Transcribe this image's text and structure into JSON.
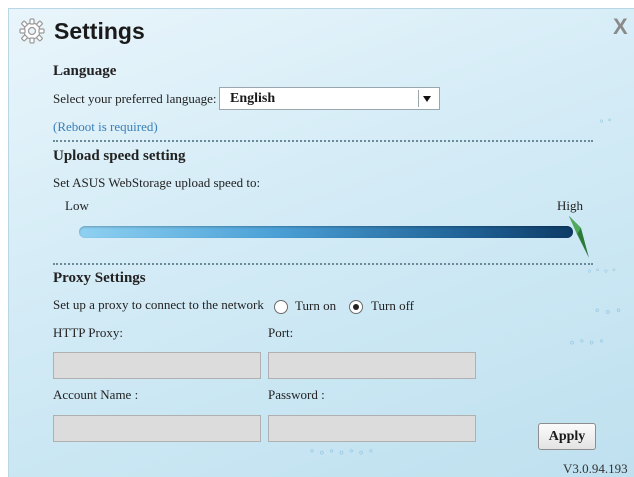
{
  "window": {
    "title": "Settings",
    "close_label": "X",
    "icon": "gear-icon"
  },
  "language": {
    "heading": "Language",
    "prompt": "Select your preferred language:",
    "selected": "English",
    "note": "(Reboot is required)"
  },
  "upload": {
    "heading": "Upload speed setting",
    "prompt": "Set ASUS WebStorage upload speed to:",
    "low_label": "Low",
    "high_label": "High",
    "level": 1.0
  },
  "proxy": {
    "heading": "Proxy Settings",
    "prompt": "Set up a proxy to connect to the network",
    "turn_on_label": "Turn on",
    "turn_off_label": "Turn off",
    "selected": "Turn off",
    "http_proxy_label": "HTTP Proxy:",
    "port_label": "Port:",
    "account_label": "Account Name :",
    "password_label": "Password :",
    "http_proxy_value": "",
    "port_value": "",
    "account_value": "",
    "password_value": ""
  },
  "actions": {
    "apply_label": "Apply"
  },
  "footer": {
    "version": "V3.0.94.193"
  },
  "colors": {
    "background": "#d7edf7",
    "slider_start": "#8fd1f2",
    "slider_end": "#0d3b66",
    "thumb": "#2a7a3a",
    "link": "#3a7fb8"
  }
}
